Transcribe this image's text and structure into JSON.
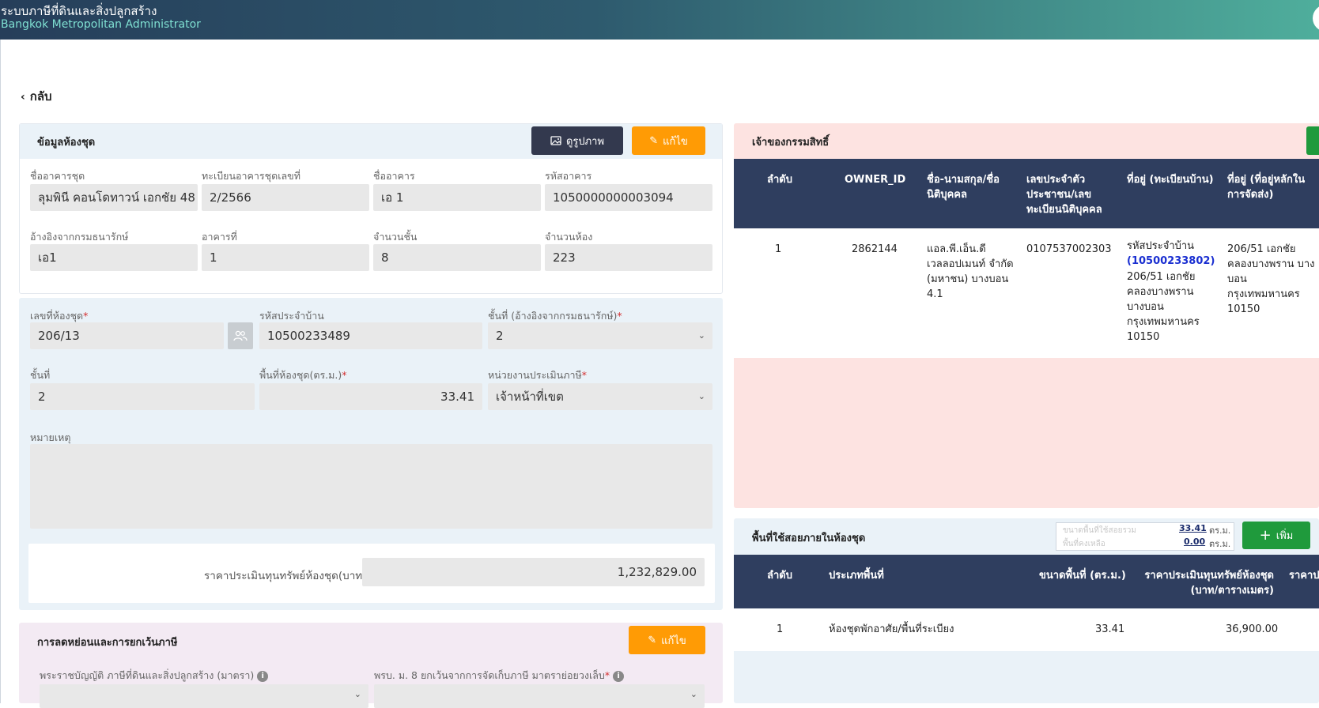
{
  "header": {
    "title": "ระบบภาษีที่ดินและสิ่งปลูกสร้าง",
    "subtitle": "Bangkok Metropolitan Administrator"
  },
  "back_label": "กลับ",
  "unit_info": {
    "title": "ข้อมูลห้องชุด",
    "view_image_label": "ดูรูปภาพ",
    "edit_label": "แก้ไข",
    "fields": {
      "condo_name": {
        "label": "ชื่ออาคารชุด",
        "value": "ลุมพินี คอนโดทาวน์ เอกชัย 48"
      },
      "condo_reg_no": {
        "label": "ทะเบียนอาคารชุดเลขที่",
        "value": "2/2566"
      },
      "building_name": {
        "label": "ชื่ออาคาร",
        "value": "เอ 1"
      },
      "building_code": {
        "label": "รหัสอาคาร",
        "value": "1050000000003094"
      },
      "ref_land_dept": {
        "label": "อ้างอิงจากกรมธนารักษ์",
        "value": "เอ1"
      },
      "building_no": {
        "label": "อาคารที่",
        "value": "1"
      },
      "floor_count": {
        "label": "จำนวนชั้น",
        "value": "8"
      },
      "room_count": {
        "label": "จำนวนห้อง",
        "value": "223"
      }
    }
  },
  "room_form": {
    "room_no": {
      "label": "เลขที่ห้องชุด",
      "value": "206/13"
    },
    "house_code": {
      "label": "รหัสประจำบ้าน",
      "value": "10500233489"
    },
    "floor_ref": {
      "label": "ชั้นที่ (อ้างอิงจากกรมธนารักษ์)",
      "value": "2"
    },
    "floor": {
      "label": "ชั้นที่",
      "value": "2"
    },
    "area": {
      "label": "พื้นที่ห้องชุด(ตร.ม.)",
      "value": "33.41"
    },
    "assess_unit": {
      "label": "หน่วยงานประเมินภาษี",
      "value": "เจ้าหน้าที่เขต"
    },
    "remark": {
      "label": "หมายเหตุ",
      "value": ""
    },
    "appraisal": {
      "label": "ราคาประเมินทุนทรัพย์ห้องชุด(บาท)",
      "value": "1,232,829.00"
    },
    "required_mark": "*"
  },
  "reduction": {
    "title": "การลดหย่อนและการยกเว้นภาษี",
    "edit_label": "แก้ไข",
    "act_label": "พระราชบัญญัติ ภาษีที่ดินและสิ่งปลูกสร้าง (มาตรา)",
    "decree_label": "พรบ. ม. 8 ยกเว้นจากการจัดเก็บภาษี มาตราย่อยวงเล็บ",
    "info_glyph": "i"
  },
  "owners": {
    "title": "เจ้าของกรรมสิทธิ์",
    "columns": [
      "ลำดับ",
      "OWNER_ID",
      "ชื่อ-นามสกุล/ชื่อนิติบุคคล",
      "เลขประจำตัวประชาชน/เลขทะเบียนนิติบุคคล",
      "ที่อยู่ (ทะเบียนบ้าน)",
      "ที่อยู่ (ที่อยู่หลักในการจัดส่ง)"
    ],
    "rows": [
      {
        "seq": "1",
        "owner_id": "2862144",
        "name": "แอล.พี.เอ็น.ดีเวลลอปเมนท์ จำกัด (มหาชน) บางบอน 4.1",
        "tax_id": "0107537002303",
        "house_code_label": "รหัสประจำบ้าน",
        "house_code": "(10500233802)",
        "reg_address": "206/51 เอกชัย คลองบางพราน บางบอน กรุงเทพมหานคร 10150",
        "mail_address": "206/51 เอกชัย คลองบางพราน บางบอน กรุงเทพมหานคร 10150"
      }
    ]
  },
  "usage": {
    "title": "พื้นที่ใช้สอยภายในห้องชุด",
    "summary_total_label": "ขนาดพื้นที่ใช้สอยรวม",
    "summary_total": "33.41",
    "summary_remain_label": "พื้นที่คงเหลือ",
    "summary_remain": "0.00",
    "unit": "ตร.ม.",
    "add_label": "เพิ่ม",
    "columns": [
      "ลำดับ",
      "ประเภทพื้นที่",
      "ขนาดพื้นที่ (ตร.ม.)",
      "ราคาประเมินทุนทรัพย์ห้องชุด (บาท/ตารางเมตร)",
      "ราคาป"
    ],
    "rows": [
      {
        "seq": "1",
        "type": "ห้องชุดพักอาศัย/พื้นที่ระเบียง",
        "area": "33.41",
        "price": "36,900.00"
      }
    ]
  },
  "colors": {
    "header_start": "#263e5a",
    "header_end": "#4fae9c",
    "orange": "#ff9b05",
    "dark": "#33394e",
    "green": "#1f9a3c",
    "table_head": "#2f3e5f",
    "pink": "#fde3e1",
    "lightblue": "#eaf2f8"
  }
}
